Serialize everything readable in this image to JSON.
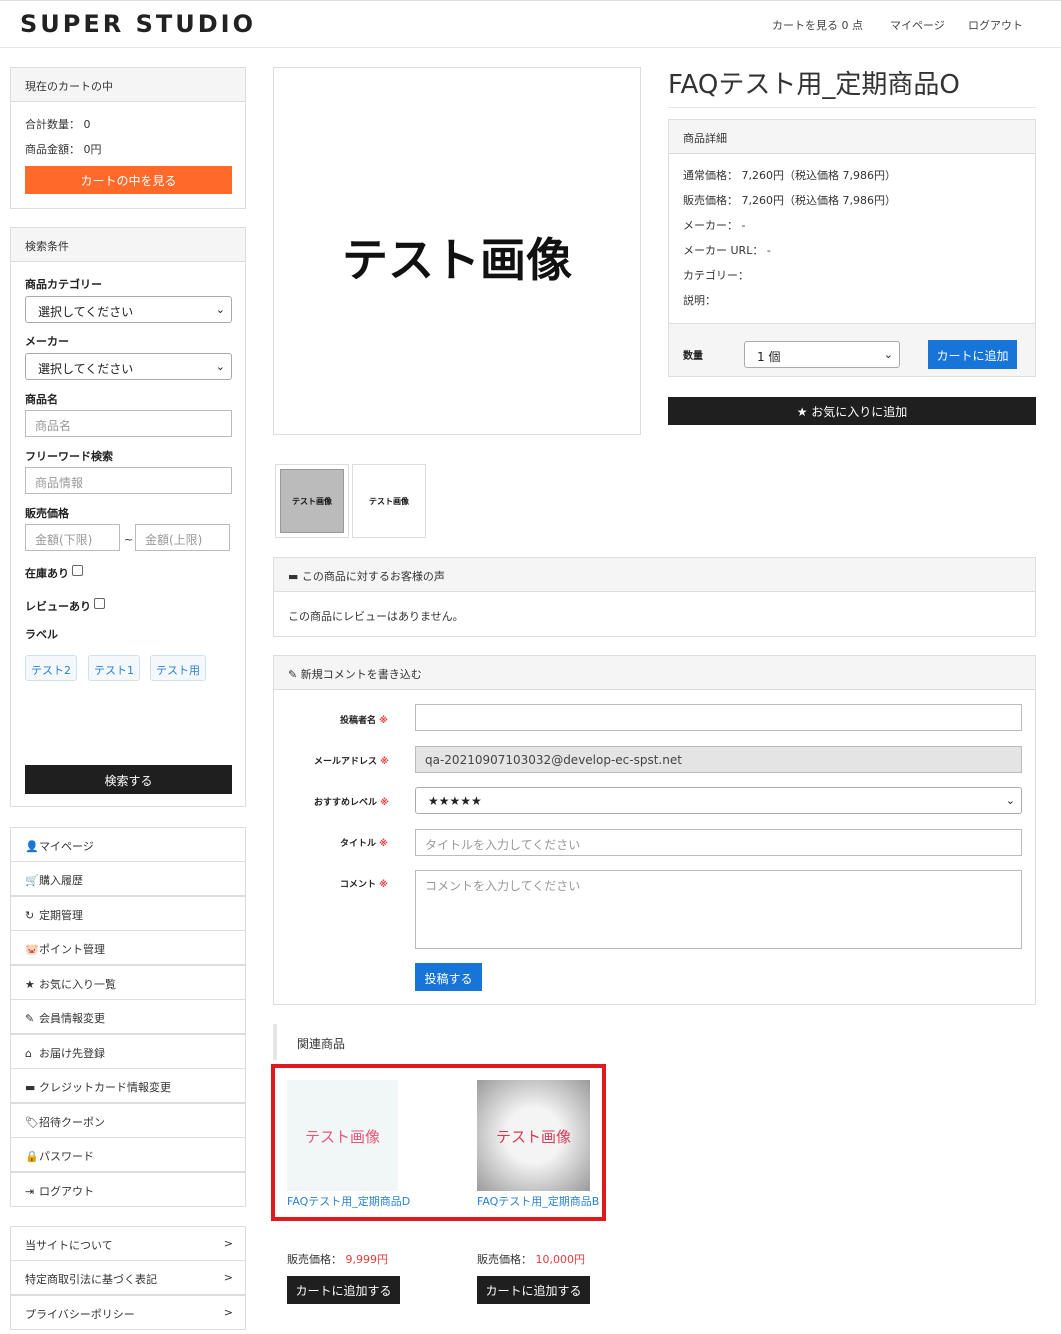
{
  "header": {
    "logo": "SUPER STUDIO",
    "nav_cart": "カートを見る 0 点",
    "nav_mypage": "マイページ",
    "nav_logout": "ログアウト"
  },
  "cart_panel": {
    "title": "現在のカートの中",
    "qty_label": "合計数量：",
    "qty_value": "0",
    "amount_label": "商品金額：",
    "amount_value": "0円",
    "view_button": "カートの中を見る"
  },
  "search_panel": {
    "title": "検索条件",
    "category_label": "商品カテゴリー",
    "category_value": "選択してください",
    "maker_label": "メーカー",
    "maker_value": "選択してください",
    "name_label": "商品名",
    "name_placeholder": "商品名",
    "freeword_label": "フリーワード検索",
    "freeword_placeholder": "商品情報",
    "price_label": "販売価格",
    "price_min_placeholder": "金額(下限)",
    "price_sep": "~",
    "price_max_placeholder": "金額(上限)",
    "stock_label": "在庫あり",
    "review_label": "レビューあり",
    "label_label": "ラベル",
    "tags": [
      "テスト2",
      "テスト1",
      "テスト用"
    ],
    "search_button": "検索する"
  },
  "account_menu": [
    {
      "icon": "user-icon",
      "glyph": "👤",
      "label": "マイページ"
    },
    {
      "icon": "cart-icon",
      "glyph": "🛒",
      "label": "購入履歴"
    },
    {
      "icon": "refresh-icon",
      "glyph": "↻",
      "label": "定期管理"
    },
    {
      "icon": "piggy-bank-icon",
      "glyph": "🐷",
      "label": "ポイント管理"
    },
    {
      "icon": "star-icon",
      "glyph": "★",
      "label": "お気に入り一覧"
    },
    {
      "icon": "pencil-icon",
      "glyph": "✎",
      "label": "会員情報変更"
    },
    {
      "icon": "home-icon",
      "glyph": "⌂",
      "label": "お届け先登録"
    },
    {
      "icon": "credit-card-icon",
      "glyph": "▬",
      "label": "クレジットカード情報変更"
    },
    {
      "icon": "tag-icon",
      "glyph": "🏷",
      "label": "招待クーポン"
    },
    {
      "icon": "lock-icon",
      "glyph": "🔒",
      "label": "パスワード"
    },
    {
      "icon": "logout-icon",
      "glyph": "⇥",
      "label": "ログアウト"
    }
  ],
  "info_links": [
    {
      "label": "当サイトについて",
      "arrow": ">"
    },
    {
      "label": "特定商取引法に基づく表記",
      "arrow": ">"
    },
    {
      "label": "プライバシーポリシー",
      "arrow": ">"
    }
  ],
  "product": {
    "title": "FAQテスト用_定期商品O",
    "main_image_text": "テスト画像",
    "thumb1_text": "テスト画像",
    "thumb2_text": "テスト画像",
    "detail_title": "商品詳細",
    "regular_price": "通常価格： 7,260円（税込価格 7,986円）",
    "sale_price": "販売価格： 7,260円（税込価格 7,986円）",
    "maker": "メーカー： -",
    "maker_url": "メーカー URL： -",
    "category": "カテゴリー：",
    "description": "説明：",
    "qty_label": "数量",
    "qty_value": "1 個",
    "add_cart_button": "カートに追加",
    "favorite_button": "★ お気に入りに追加"
  },
  "reviews": {
    "title": "この商品に対するお客様の声",
    "empty_text": "この商品にレビューはありません。"
  },
  "comment_form": {
    "title": "新規コメントを書き込む",
    "required_mark": "※",
    "name_label": "投稿者名",
    "email_label": "メールアドレス",
    "email_value": "qa-20210907103032@develop-ec-spst.net",
    "rating_label": "おすすめレベル",
    "rating_value": "★★★★★",
    "title_label": "タイトル",
    "title_placeholder": "タイトルを入力してください",
    "comment_label": "コメント",
    "comment_placeholder": "コメントを入力してください",
    "submit_button": "投稿する"
  },
  "related": {
    "title": "関連商品",
    "items": [
      {
        "image_text": "テスト画像",
        "name": "FAQテスト用_定期商品D",
        "price_label": "販売価格：",
        "price": "9,999円",
        "button": "カートに追加する"
      },
      {
        "image_text": "テスト画像",
        "name": "FAQテスト用_定期商品B",
        "price_label": "販売価格：",
        "price": "10,000円",
        "button": "カートに追加する"
      }
    ]
  },
  "colors": {
    "accent_orange": "#ff6a2b",
    "primary_blue": "#1775d9",
    "dark_button": "#1f1f1f",
    "highlight_red": "#e0191e"
  }
}
